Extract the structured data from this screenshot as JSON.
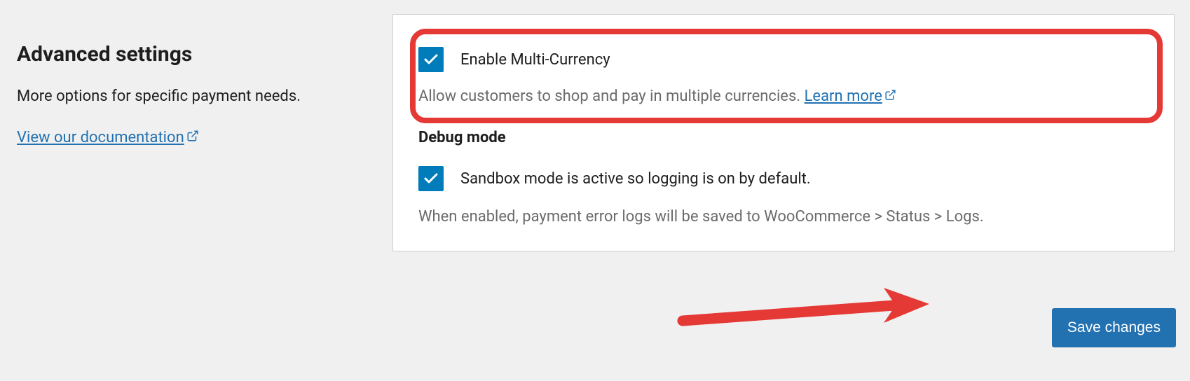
{
  "left": {
    "heading": "Advanced settings",
    "description": "More options for specific payment needs.",
    "doc_link": "View our documentation"
  },
  "panel": {
    "multi_currency": {
      "label": "Enable Multi-Currency",
      "help": "Allow customers to shop and pay in multiple currencies. ",
      "learn_more": "Learn more",
      "checked": true
    },
    "debug": {
      "section_label": "Debug mode",
      "label": "Sandbox mode is active so logging is on by default.",
      "help": "When enabled, payment error logs will be saved to WooCommerce > Status > Logs.",
      "checked": true
    }
  },
  "save_label": "Save changes",
  "colors": {
    "primary": "#2271b1",
    "checkbox": "#007cba",
    "highlight": "#e53935"
  }
}
